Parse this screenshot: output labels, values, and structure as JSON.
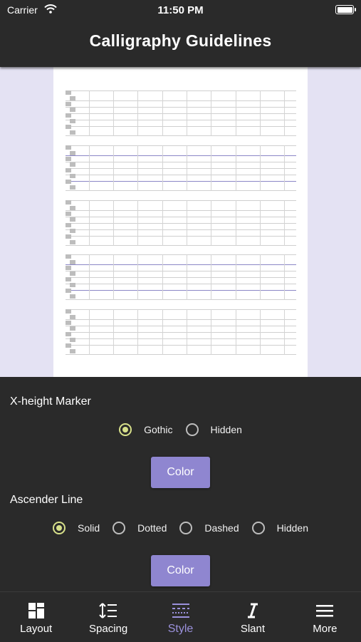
{
  "status_bar": {
    "carrier": "Carrier",
    "time": "11:50 PM"
  },
  "header": {
    "title": "Calligraphy Guidelines"
  },
  "settings": {
    "x_height_marker": {
      "label": "X-height Marker",
      "options": [
        "Gothic",
        "Hidden"
      ],
      "selected": "Gothic",
      "color_button": "Color"
    },
    "ascender_line": {
      "label": "Ascender Line",
      "options": [
        "Solid",
        "Dotted",
        "Dashed",
        "Hidden"
      ],
      "selected": "Solid",
      "color_button": "Color"
    }
  },
  "tabs": [
    {
      "label": "Layout",
      "icon": "layout-icon"
    },
    {
      "label": "Spacing",
      "icon": "spacing-icon"
    },
    {
      "label": "Style",
      "icon": "style-icon",
      "active": true
    },
    {
      "label": "Slant",
      "icon": "slant-icon"
    },
    {
      "label": "More",
      "icon": "menu-icon"
    }
  ],
  "colors": {
    "accent": "#8f86d0",
    "radio_selected": "#d7e08a",
    "guideline": "#8b86c6",
    "preview_background": "#e4e2f3"
  }
}
